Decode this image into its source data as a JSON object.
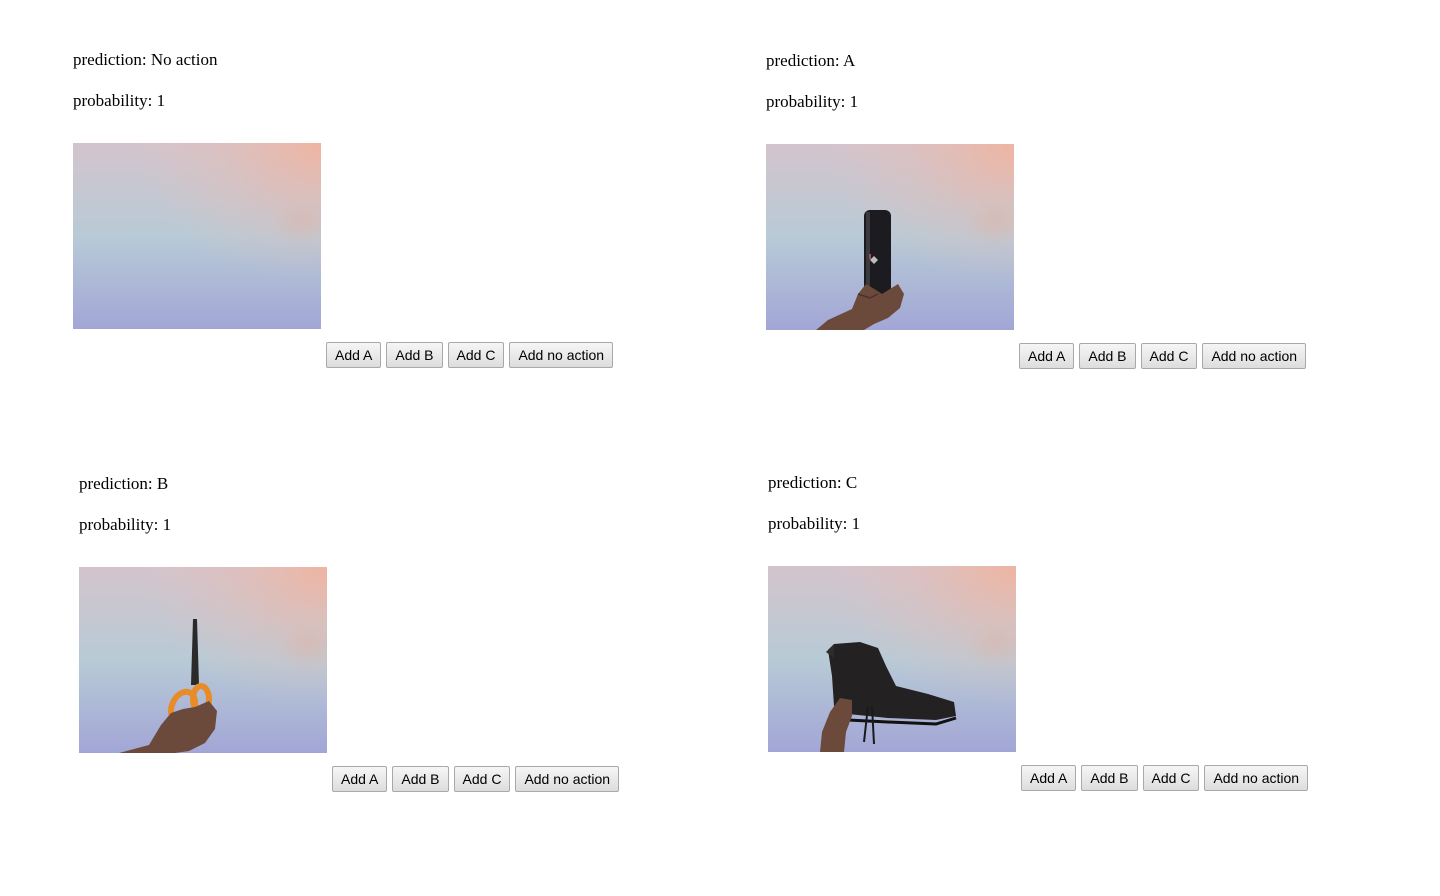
{
  "panels": [
    {
      "prediction_label": "prediction:",
      "prediction": "No action",
      "probability_label": "probability:",
      "probability": "1",
      "frame_content": "empty-background",
      "buttons": [
        "Add A",
        "Add B",
        "Add C",
        "Add no action"
      ]
    },
    {
      "prediction_label": "prediction:",
      "prediction": "A",
      "probability_label": "probability:",
      "probability": "1",
      "frame_content": "hand-holding-black-bottle",
      "buttons": [
        "Add A",
        "Add B",
        "Add C",
        "Add no action"
      ]
    },
    {
      "prediction_label": "prediction:",
      "prediction": "B",
      "probability_label": "probability:",
      "probability": "1",
      "frame_content": "hand-holding-orange-scissors",
      "buttons": [
        "Add A",
        "Add B",
        "Add C",
        "Add no action"
      ]
    },
    {
      "prediction_label": "prediction:",
      "prediction": "C",
      "probability_label": "probability:",
      "probability": "1",
      "frame_content": "hand-holding-black-boot",
      "buttons": [
        "Add A",
        "Add B",
        "Add C",
        "Add no action"
      ]
    }
  ],
  "colors": {
    "frame_top_left": "#d2c3cb",
    "frame_top_right": "#eab7a6",
    "frame_middle": "#b6c9d4",
    "frame_bottom": "#a1a7d6",
    "skin": "#6b4a3c",
    "bottle": "#1c1c20",
    "scissors_handle": "#e88c2a",
    "boot": "#232121"
  }
}
